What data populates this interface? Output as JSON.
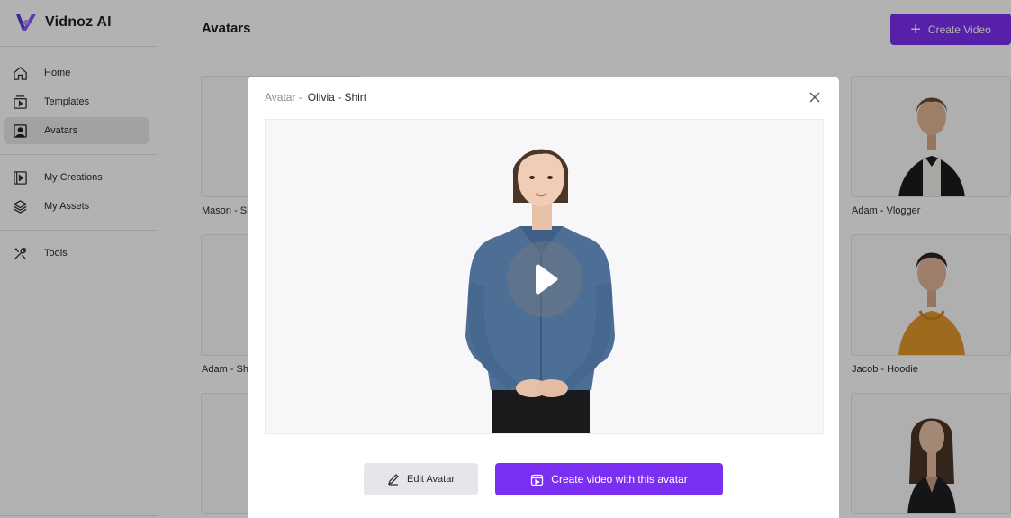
{
  "app": {
    "name": "Vidnoz AI"
  },
  "sidebar": {
    "items": [
      {
        "label": "Home",
        "icon": "home-icon"
      },
      {
        "label": "Templates",
        "icon": "templates-icon"
      },
      {
        "label": "Avatars",
        "icon": "avatar-icon",
        "active": true
      },
      {
        "label": "My Creations",
        "icon": "play-square-icon"
      },
      {
        "label": "My Assets",
        "icon": "layers-icon"
      },
      {
        "label": "Tools",
        "icon": "tools-icon"
      }
    ]
  },
  "header": {
    "title": "Avatars",
    "create_label": "Create Video"
  },
  "cards": [
    {
      "name": "Mason - Sh"
    },
    {
      "name": "Adam - Sh"
    },
    {
      "name": ""
    },
    {
      "name": "Adam - Vlogger"
    },
    {
      "name": "Jacob - Hoodie"
    },
    {
      "name": ""
    }
  ],
  "modal": {
    "prefix": "Avatar -",
    "avatar_name": "Olivia - Shirt",
    "edit_label": "Edit Avatar",
    "create_label": "Create video with this avatar"
  },
  "colors": {
    "accent": "#7b2ff2",
    "overlay": "rgba(0,0,0,0.30)"
  }
}
